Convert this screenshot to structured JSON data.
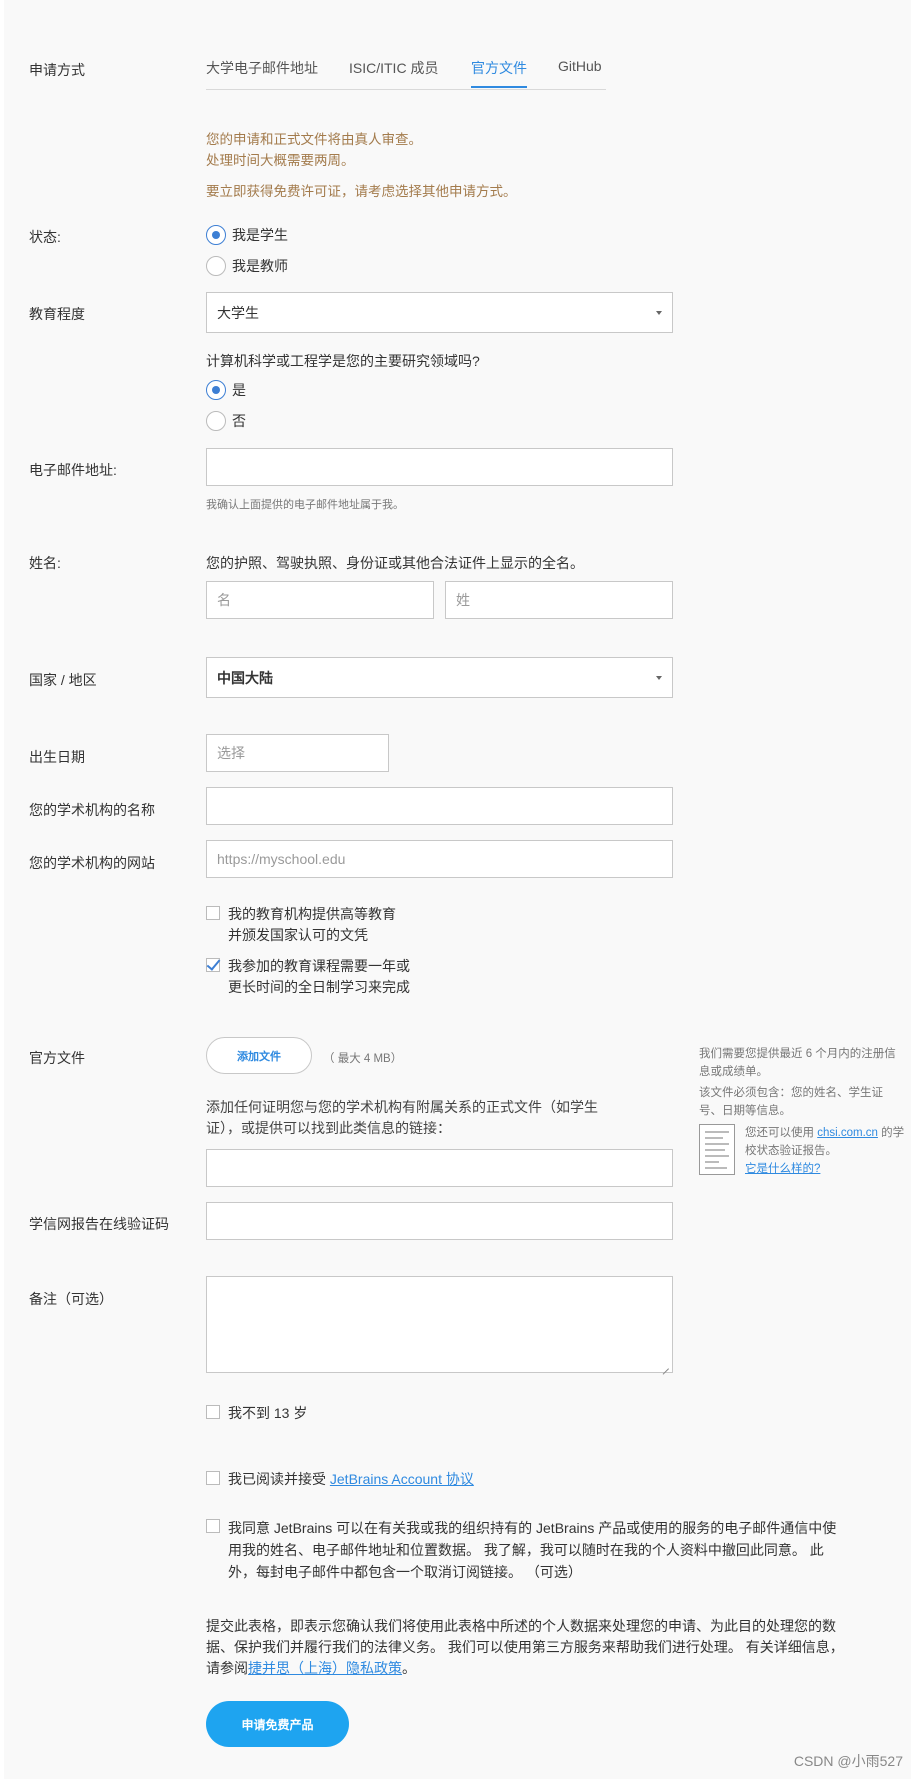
{
  "method": {
    "label": "申请方式",
    "tabs": [
      {
        "label": "大学电子邮件地址",
        "active": false
      },
      {
        "label": "ISIC/ITIC 成员",
        "active": false
      },
      {
        "label": "官方文件",
        "active": true
      },
      {
        "label": "GitHub",
        "active": false
      }
    ],
    "notes": [
      "您的申请和正式文件将由真人审查。",
      "处理时间大概需要两周。",
      "要立即获得免费许可证，请考虑选择其他申请方式。"
    ]
  },
  "status": {
    "label": "状态:",
    "options": [
      {
        "label": "我是学生",
        "selected": true
      },
      {
        "label": "我是教师",
        "selected": false
      }
    ]
  },
  "education": {
    "label": "教育程度",
    "value": "大学生"
  },
  "cs_question": {
    "text": "计算机科学或工程学是您的主要研究领域吗?",
    "options": [
      {
        "label": "是",
        "selected": true
      },
      {
        "label": "否",
        "selected": false
      }
    ]
  },
  "email": {
    "label": "电子邮件地址:",
    "value": "",
    "hint": "我确认上面提供的电子邮件地址属于我。"
  },
  "name": {
    "label": "姓名:",
    "description": "您的护照、驾驶执照、身份证或其他合法证件上显示的全名。",
    "first_placeholder": "名",
    "last_placeholder": "姓"
  },
  "country": {
    "label": "国家 / 地区",
    "value": "中国大陆"
  },
  "birthdate": {
    "label": "出生日期",
    "placeholder": "选择"
  },
  "institution_name": {
    "label": "您的学术机构的名称",
    "value": ""
  },
  "institution_site": {
    "label": "您的学术机构的网站",
    "placeholder": "https://myschool.edu"
  },
  "checks": {
    "higher_ed": {
      "line1": "我的教育机构提供高等教育",
      "line2": "并颁发国家认可的文凭",
      "checked": false
    },
    "full_time": {
      "line1": "我参加的教育课程需要一年或",
      "line2": "更长时间的全日制学习来完成",
      "checked": true
    }
  },
  "official_doc": {
    "label": "官方文件",
    "add_button": "添加文件",
    "max_size": "（ 最大 4 MB）",
    "desc_line1": "添加任何证明您与您的学术机构有附属关系的正式文件（如学生",
    "desc_line2": "证），或提供可以找到此类信息的链接：",
    "link_value": ""
  },
  "sidebar": {
    "line1": "我们需要您提供最近 6 个月内的注册信",
    "line2": "息或成绩单。",
    "line3": "该文件必须包含：您的姓名、学生证",
    "line4": "号、日期等信息。",
    "chsi_prefix": "您还可以使用 ",
    "chsi_link": "chsi.com.cn",
    "chsi_suffix": " 的学",
    "chsi_line2": "校状态验证报告。",
    "what_link": "它是什么样的?"
  },
  "chsi_code": {
    "label": "学信网报告在线验证码",
    "value": ""
  },
  "remarks": {
    "label": "备注（可选）",
    "value": ""
  },
  "under13": {
    "label": "我不到 13 岁",
    "checked": false
  },
  "agreement": {
    "prefix": "我已阅读并接受 ",
    "link": "JetBrains Account 协议",
    "checked": false
  },
  "marketing": {
    "line1": "我同意 JetBrains 可以在有关我或我的组织持有的 JetBrains 产品或使用的服务的电子邮件通信中使",
    "line2": "用我的姓名、电子邮件地址和位置数据。 我了解，我可以随时在我的个人资料中撤回此同意。 此",
    "line3": "外，每封电子邮件中都包含一个取消订阅链接。 （可选）",
    "checked": false
  },
  "privacy": {
    "line1": "提交此表格，即表示您确认我们将使用此表格中所述的个人数据来处理您的申请、为此目的处理您的数",
    "line2": "据、保护我们并履行我们的法律义务。 我们可以使用第三方服务来帮助我们进行处理。 有关详细信息，",
    "line3_prefix": "请参阅",
    "line3_link": "捷并思（上海）隐私政策",
    "line3_suffix": "。"
  },
  "submit_button": "申请免费产品",
  "watermark": "CSDN @小雨527"
}
